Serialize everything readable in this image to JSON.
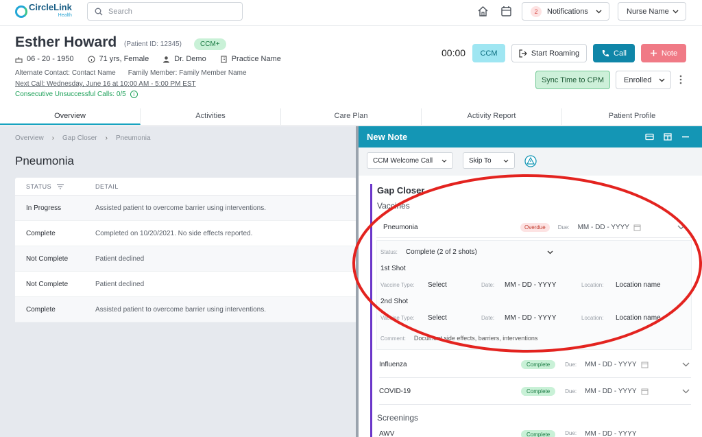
{
  "app": {
    "logo_main": "CircleLink",
    "logo_sub": "Health"
  },
  "topbar": {
    "search_placeholder": "Search",
    "notifications_count": "2",
    "notifications_label": "Notifications",
    "user": "Nurse Name"
  },
  "patient": {
    "name": "Esther Howard",
    "id_text": "(Patient ID: 12345)",
    "badge": "CCM+",
    "dob": "06 - 20 - 1950",
    "age_gender": "71 yrs, Female",
    "doctor": "Dr. Demo",
    "practice": "Practice Name",
    "alt_contact": "Alternate Contact: Contact Name",
    "family": "Family Member: Family Member Name",
    "next_call": "Next Call: Wednesday, June 16 at 10:00 AM - 5:00 PM EST",
    "consecutive": "Consecutive Unsuccessful Calls: 0/5"
  },
  "actions": {
    "timer": "00:00",
    "ccm": "CCM",
    "start_roaming": "Start Roaming",
    "call": "Call",
    "note": "Note",
    "sync": "Sync Time to CPM",
    "enrolled": "Enrolled"
  },
  "tabs": [
    "Overview",
    "Activities",
    "Care Plan",
    "Activity Report",
    "Patient Profile"
  ],
  "breadcrumb": [
    "Overview",
    "Gap Closer",
    "Pneumonia"
  ],
  "section_title": "Pneumonia",
  "table": {
    "headers": [
      "STATUS",
      "DETAIL"
    ],
    "rows": [
      {
        "status": "In Progress",
        "detail": "Assisted patient to overcome barrier using interventions."
      },
      {
        "status": "Complete",
        "detail": "Completed on 10/20/2021. No side effects reported."
      },
      {
        "status": "Not Complete",
        "detail": "Patient declined"
      },
      {
        "status": "Not Complete",
        "detail": "Patient declined"
      },
      {
        "status": "Complete",
        "detail": "Assisted patient to overcome barrier using interventions."
      }
    ]
  },
  "note_panel": {
    "title": "New Note",
    "welcome_select": "CCM Welcome Call",
    "skip_select": "Skip To",
    "gap_title": "Gap Closer",
    "vaccines_label": "Vaccines",
    "pneumonia": {
      "name": "Pneumonia",
      "badge": "Overdue",
      "due_label": "Due:",
      "date": "MM - DD - YYYY",
      "status_label": "Status:",
      "status_value": "Complete (2 of 2 shots)",
      "shot1": "1st Shot",
      "shot2": "2nd Shot",
      "vaccine_type_label": "Vaccine Type:",
      "vaccine_type_value": "Select",
      "date_label": "Date:",
      "date_value": "MM - DD - YYYY",
      "location_label": "Location:",
      "location_value": "Location name",
      "comment_label": "Comment:",
      "comment_value": "Document side effects, barriers, interventions"
    },
    "items": [
      {
        "name": "Influenza",
        "badge": "Complete",
        "due_label": "Due:",
        "date": "MM - DD - YYYY"
      },
      {
        "name": "COVID-19",
        "badge": "Complete",
        "due_label": "Due:",
        "date": "MM - DD - YYYY"
      }
    ],
    "screenings_label": "Screenings",
    "partial_item": {
      "name": "AWV",
      "badge": "Complete",
      "due_label": "Due:",
      "date": "MM - DD - YYYY"
    }
  },
  "colors": {
    "accent": "#1496b5",
    "annotation": "#e3231f",
    "purple": "#6b36c9"
  }
}
